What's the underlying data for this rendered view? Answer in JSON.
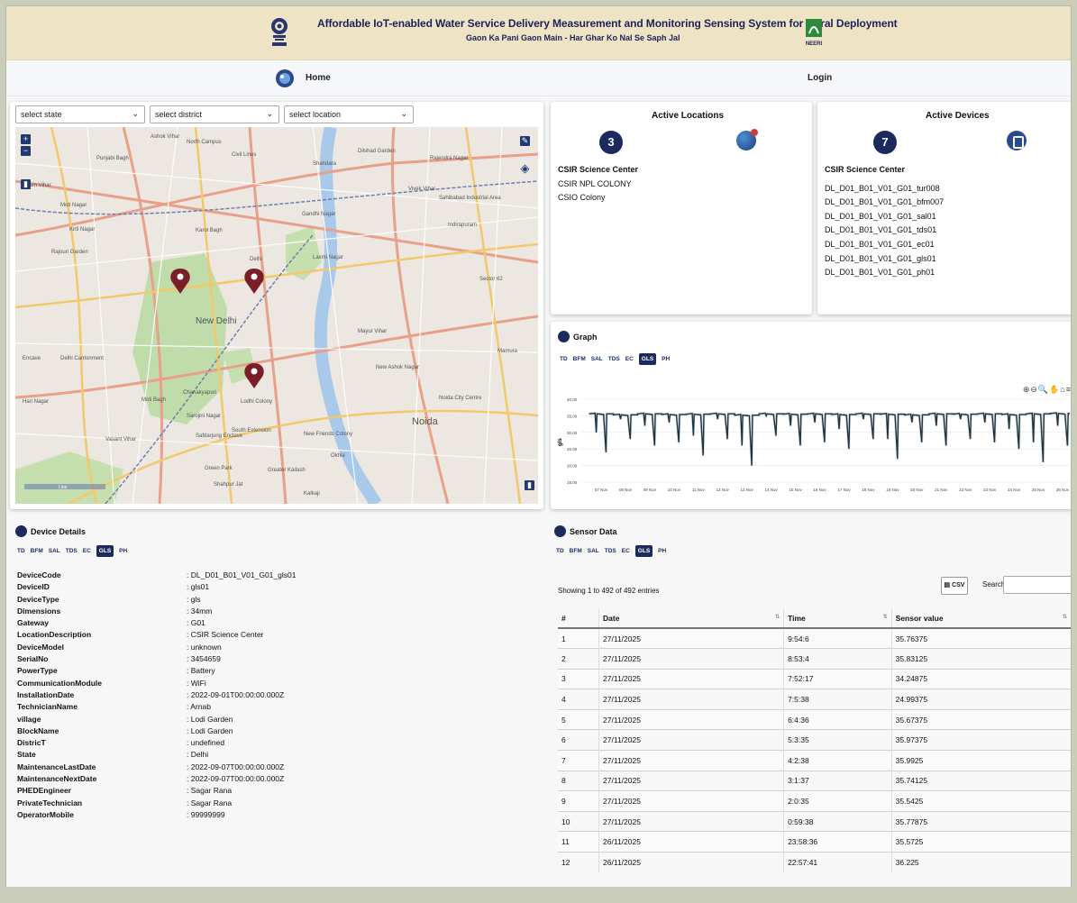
{
  "header": {
    "title": "Affordable IoT-enabled Water Service Delivery Measurement and Monitoring Sensing System for Rural Deployment",
    "subtitle": "Gaon Ka Pani Gaon Main - Har Ghar Ko Nal Se Saph Jal",
    "right_logo_text": "NEERI"
  },
  "nav": {
    "home": "Home",
    "login": "Login"
  },
  "filters": {
    "state": "select state",
    "district": "select district",
    "location": "select location"
  },
  "map": {
    "labels": [
      {
        "text": "North Campus"
      },
      {
        "text": "Ashok Vihar"
      },
      {
        "text": "Civil Lines"
      },
      {
        "text": "Shahdara"
      },
      {
        "text": "Dilshad Garden"
      },
      {
        "text": "Rajendra Nagar"
      },
      {
        "text": "Punjabi Bagh"
      },
      {
        "text": "Uttam Vihar"
      },
      {
        "text": "Moti Nagar"
      },
      {
        "text": "Kirti Nagar"
      },
      {
        "text": "Rajouri Garden"
      },
      {
        "text": "Karol Bagh"
      },
      {
        "text": "Gandhi Nagar"
      },
      {
        "text": "Vivek Vihar"
      },
      {
        "text": "Sahibabad Industrial Area"
      },
      {
        "text": "New Delhi"
      },
      {
        "text": "Delhi"
      },
      {
        "text": "Laxmi Nagar"
      },
      {
        "text": "Indirapuram"
      },
      {
        "text": "Sector 62"
      },
      {
        "text": "Delhi Cantonment"
      },
      {
        "text": "Chanakyapuri"
      },
      {
        "text": "Lodhi Colony"
      },
      {
        "text": "Mayur Vihar"
      },
      {
        "text": "New Ashok Nagar"
      },
      {
        "text": "Noida"
      },
      {
        "text": "Noida City Centre"
      },
      {
        "text": "Moti Bagh"
      },
      {
        "text": "Sarojini Nagar"
      },
      {
        "text": "Vasant Vihar"
      },
      {
        "text": "Safdarjung Enclave"
      },
      {
        "text": "South Extension"
      },
      {
        "text": "Green Park"
      },
      {
        "text": "New Friends Colony"
      },
      {
        "text": "Okhla"
      },
      {
        "text": "Greater Kailash"
      },
      {
        "text": "Shahpur Jat"
      },
      {
        "text": "Kalkaji"
      },
      {
        "text": "Mamura"
      },
      {
        "text": "Encave"
      },
      {
        "text": "Hari Nagar"
      }
    ],
    "scale_label": "Line"
  },
  "active_locations": {
    "title": "Active Locations",
    "count": "3",
    "items": [
      "CSIR Science Center",
      "CSIR NPL COLONY",
      "CSIO Colony"
    ]
  },
  "active_devices": {
    "title": "Active Devices",
    "count": "7",
    "items": [
      "CSIR Science Center",
      "DL_D01_B01_V01_G01_tur008",
      "DL_D01_B01_V01_G01_bfm007",
      "DL_D01_B01_V01_G01_sal01",
      "DL_D01_B01_V01_G01_tds01",
      "DL_D01_B01_V01_G01_ec01",
      "DL_D01_B01_V01_G01_gls01",
      "DL_D01_B01_V01_G01_ph01"
    ]
  },
  "tabs": [
    "TD",
    "BFM",
    "SAL",
    "TDS",
    "EC",
    "GLS",
    "PH"
  ],
  "active_tab": "GLS",
  "graph": {
    "title": "Graph",
    "tools": "⊕⊖🔍✋⌂≡"
  },
  "chart_data": {
    "type": "line",
    "title": "",
    "xlabel": "",
    "ylabel": "gls",
    "ylim": [
      15,
      40
    ],
    "yticks": [
      "40.00",
      "35.00",
      "30.00",
      "25.00",
      "20.00",
      "15.00"
    ],
    "categories": [
      "07 Nov",
      "08 Nov",
      "09 Nov",
      "10 Nov",
      "11 Nov",
      "12 Nov",
      "13 Nov",
      "14 Nov",
      "15 Nov",
      "16 Nov",
      "17 Nov",
      "18 Nov",
      "19 Nov",
      "20 Nov",
      "21 Nov",
      "22 Nov",
      "23 Nov",
      "24 Nov",
      "25 Nov",
      "26 Nov"
    ],
    "series": [
      {
        "values": [
          35.6,
          35.3,
          35.6,
          35.4,
          35.5,
          35.6,
          35.2,
          35.6,
          35.5,
          35.6,
          35.4,
          35.6,
          35.5,
          35.3,
          35.6,
          35.5,
          35.6,
          35.4,
          35.6,
          35.7
        ],
        "dips": [
          24,
          28,
          26,
          27,
          23,
          28,
          20,
          29,
          26,
          27,
          25,
          28,
          22,
          27,
          26,
          28,
          27,
          25,
          21,
          26
        ],
        "color": "#1f3440"
      }
    ]
  },
  "device_details": {
    "title": "Device Details",
    "rows": [
      {
        "key": "DeviceCode",
        "value": ": DL_D01_B01_V01_G01_gls01"
      },
      {
        "key": "DeviceID",
        "value": ": gls01"
      },
      {
        "key": "DeviceType",
        "value": ": gls"
      },
      {
        "key": "Dimensions",
        "value": ": 34mm"
      },
      {
        "key": "Gateway",
        "value": ": G01"
      },
      {
        "key": "LocationDescription",
        "value": ": CSIR Science Center"
      },
      {
        "key": "DeviceModel",
        "value": ": unknown"
      },
      {
        "key": "SerialNo",
        "value": ": 3454659"
      },
      {
        "key": "PowerType",
        "value": ": Battery"
      },
      {
        "key": "CommunicationModule",
        "value": ": WiFi"
      },
      {
        "key": "InstallationDate",
        "value": ": 2022-09-01T00:00:00.000Z"
      },
      {
        "key": "TechnicianName",
        "value": ": Arnab"
      },
      {
        "key": "village",
        "value": ": Lodi Garden"
      },
      {
        "key": "BlockName",
        "value": ": Lodi Garden"
      },
      {
        "key": "DistricT",
        "value": ": undefined"
      },
      {
        "key": "State",
        "value": ": Delhi"
      },
      {
        "key": "MaintenanceLastDate",
        "value": ": 2022-09-07T00:00:00.000Z"
      },
      {
        "key": "MaintenanceNextDate",
        "value": ": 2022-09-07T00:00:00.000Z"
      },
      {
        "key": "PHEDEngineer",
        "value": ": Sagar Rana"
      },
      {
        "key": "PrivateTechnician",
        "value": ": Sagar Rana"
      },
      {
        "key": "OperatorMobile",
        "value": ": 99999999"
      }
    ]
  },
  "sensor_data": {
    "title": "Sensor Data",
    "showing": "Showing 1 to 492 of 492 entries",
    "csv_label": "CSV",
    "search_label": "Search:",
    "columns": [
      "#",
      "Date",
      "Time",
      "Sensor value"
    ],
    "rows": [
      [
        "1",
        "27/11/2025",
        "9:54:6",
        "35.76375"
      ],
      [
        "2",
        "27/11/2025",
        "8:53:4",
        "35.83125"
      ],
      [
        "3",
        "27/11/2025",
        "7:52:17",
        "34.24875"
      ],
      [
        "4",
        "27/11/2025",
        "7:5:38",
        "24.99375"
      ],
      [
        "5",
        "27/11/2025",
        "6:4:36",
        "35.67375"
      ],
      [
        "6",
        "27/11/2025",
        "5:3:35",
        "35.97375"
      ],
      [
        "7",
        "27/11/2025",
        "4:2:38",
        "35.9925"
      ],
      [
        "8",
        "27/11/2025",
        "3:1:37",
        "35.74125"
      ],
      [
        "9",
        "27/11/2025",
        "2:0:35",
        "35.5425"
      ],
      [
        "10",
        "27/11/2025",
        "0:59:38",
        "35.77875"
      ],
      [
        "11",
        "26/11/2025",
        "23:58:36",
        "35.5725"
      ],
      [
        "12",
        "26/11/2025",
        "22:57:41",
        "36.225"
      ]
    ]
  }
}
